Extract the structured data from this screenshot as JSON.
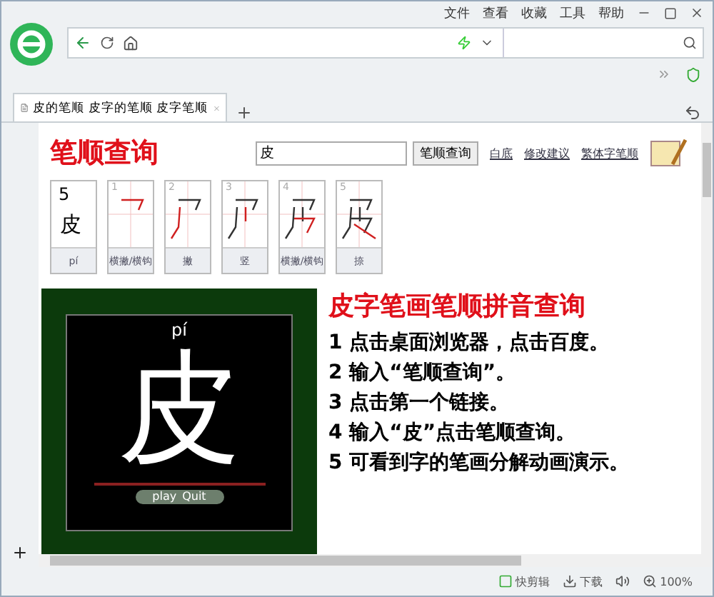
{
  "browser": {
    "menu": [
      "文件",
      "查看",
      "收藏",
      "工具",
      "帮助"
    ],
    "tab": {
      "title": "皮的笔顺 皮字的笔顺 皮字笔顺"
    }
  },
  "page": {
    "title": "笔顺查询",
    "search": {
      "value": "皮"
    },
    "search_button": "笔顺查询",
    "links": [
      "白底",
      "修改建议",
      "繁体字笔顺"
    ],
    "summary": {
      "count": "5",
      "char": "皮",
      "pinyin": "pí"
    },
    "strokes": [
      {
        "number": "1",
        "name": "横撇/横钩"
      },
      {
        "number": "2",
        "name": "撇"
      },
      {
        "number": "3",
        "name": "竖"
      },
      {
        "number": "4",
        "name": "横撇/横钩"
      },
      {
        "number": "5",
        "name": "捺"
      }
    ],
    "player": {
      "pinyin": "pí",
      "char": "皮",
      "buttons": [
        "play",
        "Quit"
      ]
    },
    "article": {
      "title": "皮字笔画笔顺拼音查询",
      "steps": [
        "1 点击桌面浏览器，点击百度。",
        "2 输入“笔顺查询”。",
        "3 点击第一个链接。",
        "4 输入“皮”点击笔顺查询。",
        "5 可看到字的笔画分解动画演示。"
      ]
    }
  },
  "status_bar": {
    "items": [
      "快剪辑",
      "下载",
      "100%"
    ]
  }
}
